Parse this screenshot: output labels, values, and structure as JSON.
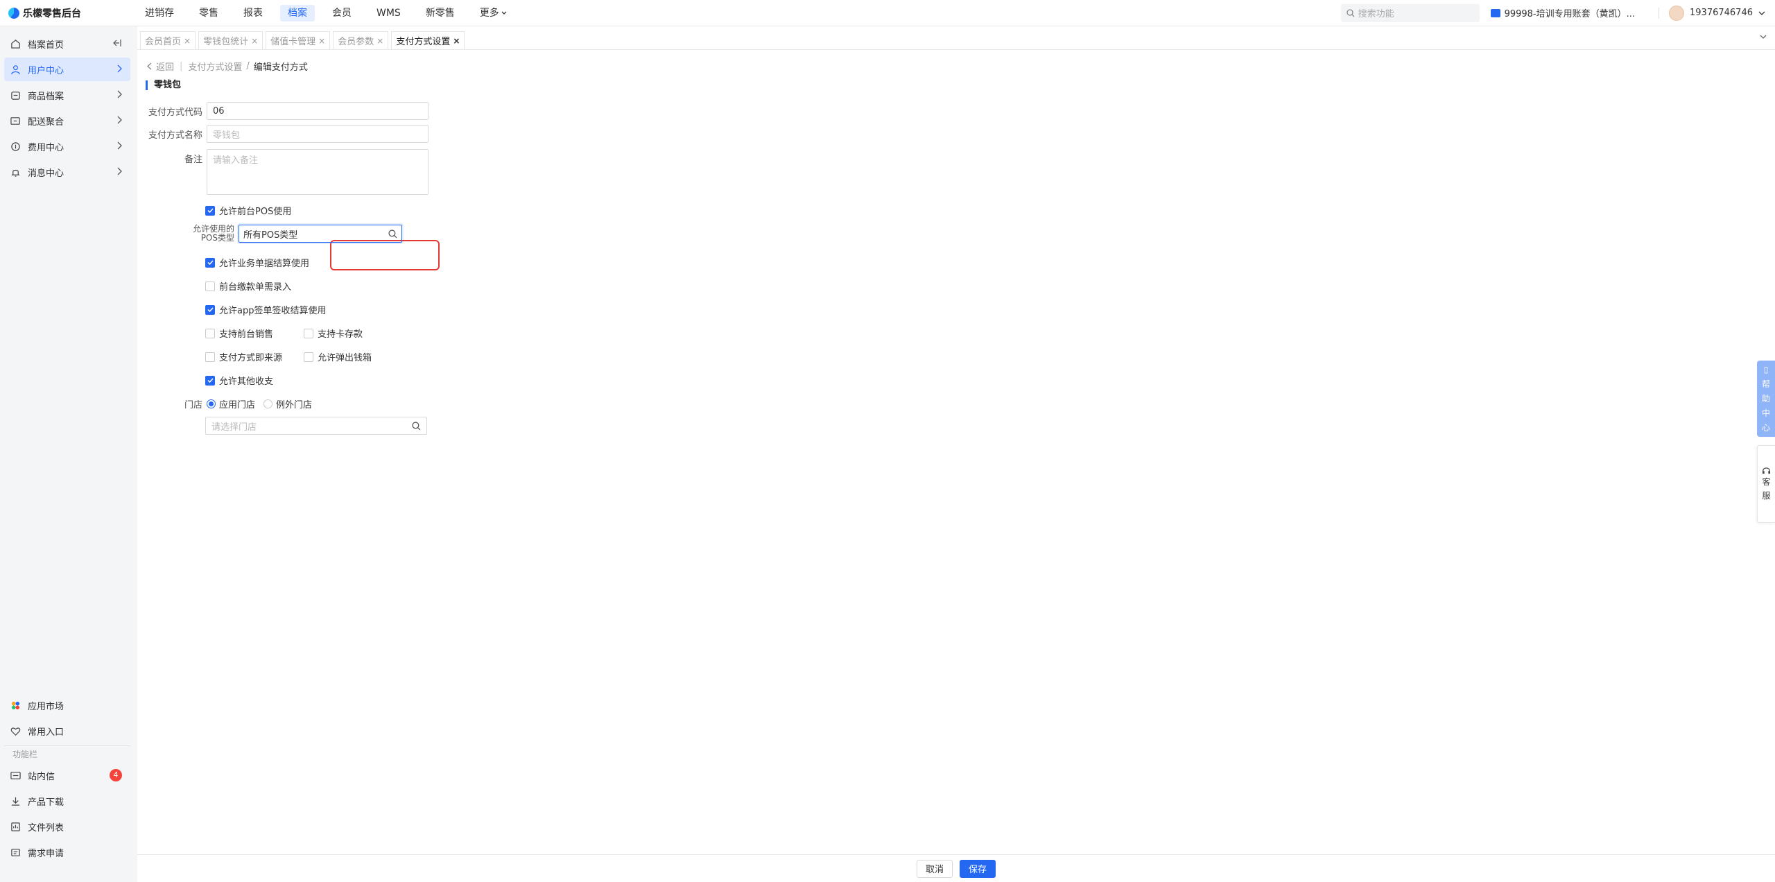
{
  "app": {
    "title": "乐檬零售后台"
  },
  "nav": {
    "items": [
      "进销存",
      "零售",
      "报表",
      "档案",
      "会员",
      "WMS",
      "新零售",
      "更多"
    ],
    "active": "档案"
  },
  "top": {
    "search_placeholder": "搜索功能",
    "account": "99998-培训专用账套（黄凯）...",
    "user": "19376746746"
  },
  "sidebar": {
    "items": [
      "档案首页",
      "用户中心",
      "商品档案",
      "配送聚合",
      "费用中心",
      "消息中心"
    ],
    "active": "用户中心",
    "bottom_items": [
      "应用市场",
      "常用入口"
    ],
    "section_label": "功能栏",
    "func_items": [
      "站内信",
      "产品下载",
      "文件列表",
      "需求申请"
    ],
    "inbox_badge": "4"
  },
  "tabs": [
    "会员首页",
    "零钱包统计",
    "储值卡管理",
    "会员参数",
    "支付方式设置"
  ],
  "tabs_close": "×",
  "breadcrumb": {
    "back": "返回",
    "parent": "支付方式设置",
    "sep": "/",
    "current": "编辑支付方式"
  },
  "section_title": "零钱包",
  "form": {
    "code_label": "支付方式代码",
    "code_value": "06",
    "name_label": "支付方式名称",
    "name_placeholder": "零钱包",
    "remark_label": "备注",
    "remark_placeholder": "请输入备注",
    "allow_pos": "允许前台POS使用",
    "pos_type_label_1": "允许使用的",
    "pos_type_label_2": "POS类型",
    "pos_type_value": "所有POS类型",
    "allow_business": "允许业务单据结算使用",
    "front_payment": "前台缴款单需录入",
    "allow_app": "允许app签单签收结算使用",
    "support_front_sale": "支持前台销售",
    "support_card_deposit": "支持卡存款",
    "payment_source": "支付方式即来源",
    "allow_cash_drawer": "允许弹出钱箱",
    "allow_other": "允许其他收支",
    "store_label": "门店",
    "store_apply": "应用门店",
    "store_except": "例外门店",
    "store_placeholder": "请选择门店"
  },
  "checks": {
    "allow_pos": true,
    "allow_business": true,
    "front_payment": false,
    "allow_app": true,
    "support_front_sale": false,
    "support_card_deposit": false,
    "payment_source": false,
    "allow_cash_drawer": false,
    "allow_other": true
  },
  "store_mode": "apply",
  "footer": {
    "cancel": "取消",
    "save": "保存"
  },
  "floats": {
    "help": [
      "帮",
      "助",
      "中",
      "心"
    ],
    "service": [
      "客",
      "服"
    ]
  },
  "colors": {
    "accent": "#2468f2",
    "highlight": "#e53935",
    "badge": "#f5433b"
  }
}
